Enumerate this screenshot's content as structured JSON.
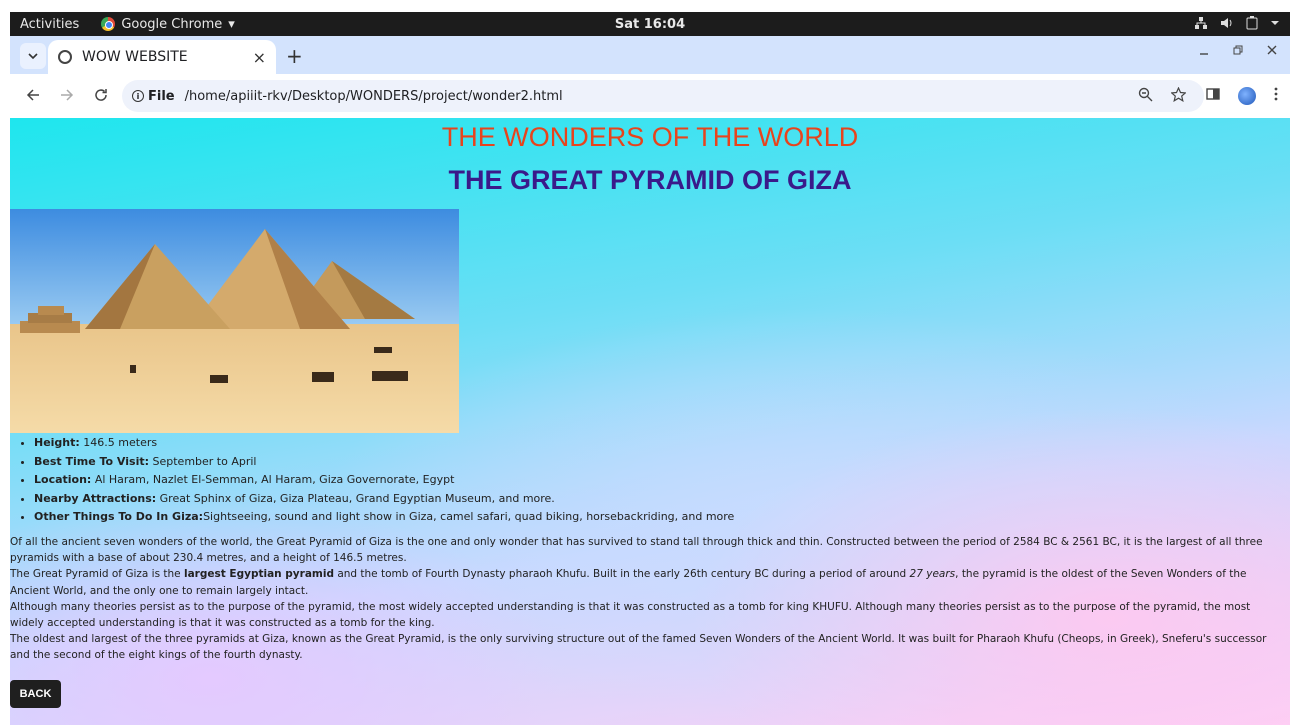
{
  "system_bar": {
    "activities": "Activities",
    "app_name": "Google Chrome",
    "app_dropdown": "▾",
    "clock": "Sat 16:04"
  },
  "browser": {
    "tab_title": "WOW WEBSITE",
    "tab_close": "×",
    "new_tab": "+",
    "address_scheme_label": "File",
    "address_url": "/home/apiiit-rkv/Desktop/WONDERS/project/wonder2.html"
  },
  "page": {
    "heading": "THE WONDERS OF THE WORLD",
    "subheading": "THE GREAT PYRAMID OF GIZA",
    "facts": [
      {
        "label": "Height:",
        "value": " 146.5 meters"
      },
      {
        "label": "Best Time To Visit:",
        "value": " September to April"
      },
      {
        "label": "Location:",
        "value": " Al Haram, Nazlet El-Semman, Al Haram, Giza Governorate, Egypt"
      },
      {
        "label": "Nearby Attractions:",
        "value": " Great Sphinx of Giza, Giza Plateau, Grand Egyptian Museum, and more."
      },
      {
        "label": "Other Things To Do In Giza:",
        "value": "Sightseeing, sound and light show in Giza, camel safari, quad biking, horsebackriding, and more"
      }
    ],
    "para1": "Of all the ancient seven wonders of the world, the Great Pyramid of Giza is the one and only wonder that has survived to stand tall through thick and thin. Constructed between the period of 2584 BC & 2561 BC, it is the largest of all three pyramids with a base of about 230.4 metres, and a height of 146.5 metres.",
    "para2_a": "The Great Pyramid of Giza is the ",
    "para2_bold": "largest Egyptian pyramid",
    "para2_b": " and the tomb of Fourth Dynasty pharaoh Khufu. Built in the early 26th century BC during a period of around ",
    "para2_italic": "27 years",
    "para2_c": ", the pyramid is the oldest of the Seven Wonders of the Ancient World, and the only one to remain largely intact.",
    "para3": "Although many theories persist as to the purpose of the pyramid, the most widely accepted understanding is that it was constructed as a tomb for king KHUFU. Although many theories persist as to the purpose of the pyramid, the most widely accepted understanding is that it was constructed as a tomb for the king.",
    "para4": "The oldest and largest of the three pyramids at Giza, known as the Great Pyramid, is the only surviving structure out of the famed Seven Wonders of the Ancient World. It was built for Pharaoh Khufu (Cheops, in Greek), Sneferu's successor and the second of the eight kings of the fourth dynasty.",
    "back_button": "BACK"
  },
  "colors": {
    "heading": "#e8431c",
    "subheading": "#3a1a8a",
    "tab_strip": "#d3e3fd",
    "back_button_bg": "#1f1f1f"
  }
}
